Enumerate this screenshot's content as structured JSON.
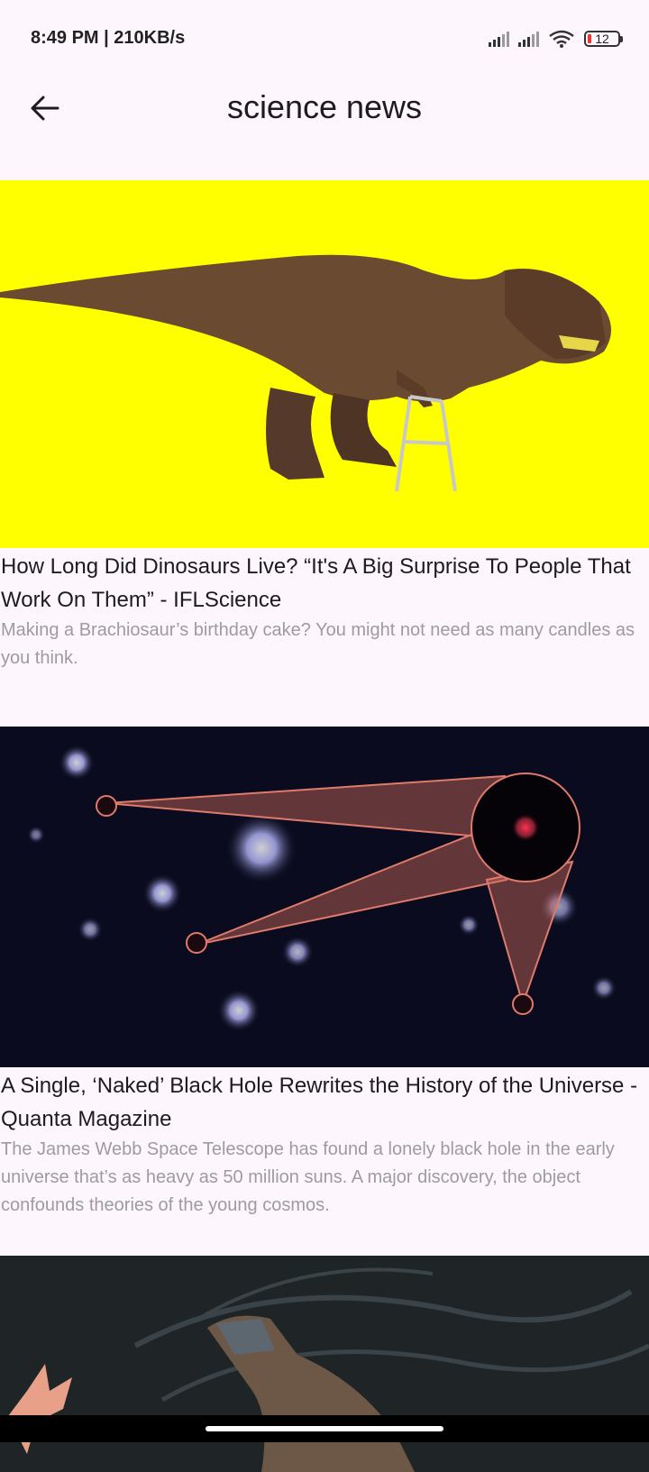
{
  "status_bar": {
    "time_speed": "8:49 PM | 210KB/s",
    "battery_level": "12"
  },
  "app_bar": {
    "title": "science news"
  },
  "articles": [
    {
      "title": "How Long Did Dinosaurs Live? “It's A Big Surprise To People That Work On Them” - IFLScience",
      "description": "Making a Brachiosaur’s birthday cake? You might not need as many candles as you think.",
      "image_background": "#ffff00"
    },
    {
      "title": "A Single, ‘Naked’ Black Hole Rewrites the History of the Universe - Quanta Magazine",
      "description": "The James Webb Space Telescope has found a lonely black hole in the early universe that’s as heavy as 50 million suns. A major discovery, the object confounds theories of the young cosmos.",
      "image_background": "#0a0b1e"
    },
    {
      "title": "",
      "description": "",
      "image_background": "#1f2527"
    }
  ],
  "colors": {
    "page_background": "#fdf7fd",
    "title_text": "#1d1b20",
    "description_text": "#9e9aa2"
  }
}
